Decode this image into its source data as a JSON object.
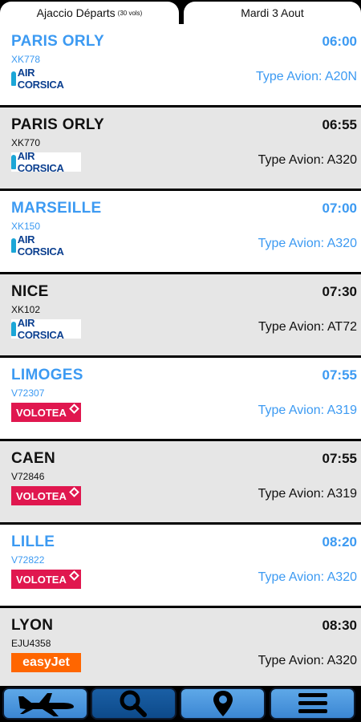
{
  "header": {
    "tab_departures_label": "Ajaccio Départs",
    "tab_departures_count": "(30 vols)",
    "tab_date_label": "Mardi 3 Aout"
  },
  "flights": [
    {
      "destination": "PARIS ORLY",
      "time": "06:00",
      "flight_no": "XK778",
      "airline": "AIR CORSICA",
      "type_label": "Type Avion: A20N",
      "color": "#3c9af2"
    },
    {
      "destination": "PARIS ORLY",
      "time": "06:55",
      "flight_no": "XK770",
      "airline": "AIR CORSICA",
      "type_label": "Type Avion: A320",
      "color": "#111111"
    },
    {
      "destination": "MARSEILLE",
      "time": "07:00",
      "flight_no": "XK150",
      "airline": "AIR CORSICA",
      "type_label": "Type Avion: A320",
      "color": "#3c9af2"
    },
    {
      "destination": "NICE",
      "time": "07:30",
      "flight_no": "XK102",
      "airline": "AIR CORSICA",
      "type_label": "Type Avion: AT72",
      "color": "#111111"
    },
    {
      "destination": "LIMOGES",
      "time": "07:55",
      "flight_no": "V72307",
      "airline": "VOLOTEA",
      "type_label": "Type Avion: A319",
      "color": "#3c9af2"
    },
    {
      "destination": "CAEN",
      "time": "07:55",
      "flight_no": "V72846",
      "airline": "VOLOTEA",
      "type_label": "Type Avion: A319",
      "color": "#111111"
    },
    {
      "destination": "LILLE",
      "time": "08:20",
      "flight_no": "V72822",
      "airline": "VOLOTEA",
      "type_label": "Type Avion: A320",
      "color": "#3c9af2"
    },
    {
      "destination": "LYON",
      "time": "08:30",
      "flight_no": "EJU4358",
      "airline": "easyJet",
      "type_label": "Type Avion: A320",
      "color": "#111111"
    }
  ],
  "nav": {
    "items": [
      {
        "icon": "airplane-icon"
      },
      {
        "icon": "search-icon"
      },
      {
        "icon": "location-pin-icon"
      },
      {
        "icon": "menu-icon"
      }
    ]
  },
  "colors": {
    "accent_blue": "#3c9af2",
    "row_gray": "#e6e6e6",
    "aircorsica_blue": "#0b3f8f",
    "volotea_red": "#e0174f",
    "easyjet_orange": "#ff6600"
  }
}
